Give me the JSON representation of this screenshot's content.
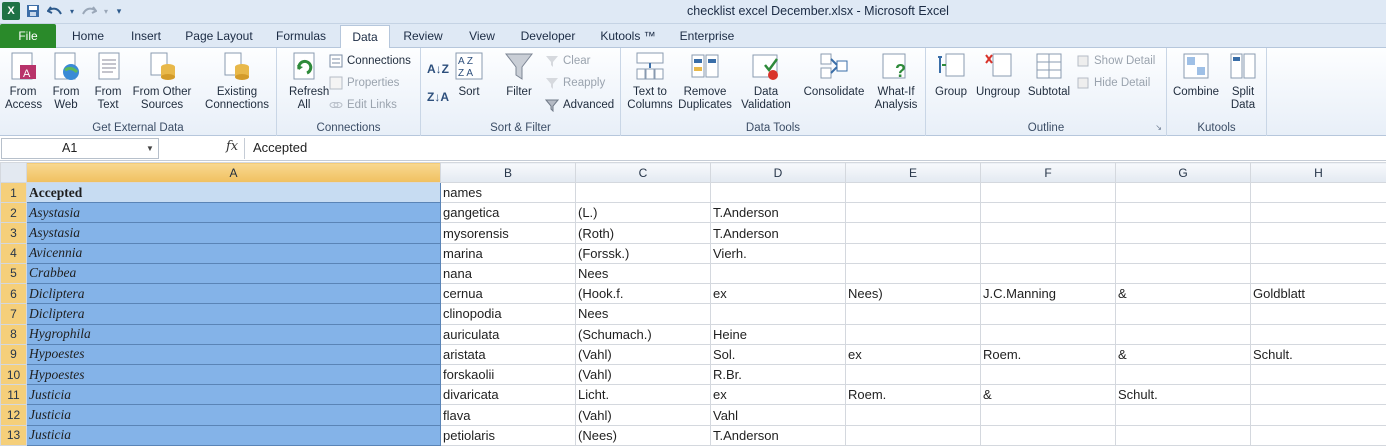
{
  "window": {
    "title": "checklist excel December.xlsx  -  Microsoft Excel"
  },
  "tabs": [
    "File",
    "Home",
    "Insert",
    "Page Layout",
    "Formulas",
    "Data",
    "Review",
    "View",
    "Developer",
    "Kutools ™",
    "Enterprise"
  ],
  "active_tab": "Data",
  "ribbon": {
    "get_external": {
      "label": "Get External Data",
      "from_access": "From Access",
      "from_web": "From Web",
      "from_text": "From Text",
      "from_other": "From Other Sources",
      "existing": "Existing Connections"
    },
    "connections": {
      "label": "Connections",
      "refresh": "Refresh All",
      "connections": "Connections",
      "properties": "Properties",
      "edit_links": "Edit Links"
    },
    "sort_filter": {
      "label": "Sort & Filter",
      "sort": "Sort",
      "filter": "Filter",
      "clear": "Clear",
      "reapply": "Reapply",
      "advanced": "Advanced"
    },
    "data_tools": {
      "label": "Data Tools",
      "text_to_columns": "Text to Columns",
      "remove_duplicates": "Remove Duplicates",
      "data_validation": "Data Validation",
      "consolidate": "Consolidate",
      "what_if": "What-If Analysis"
    },
    "outline": {
      "label": "Outline",
      "group": "Group",
      "ungroup": "Ungroup",
      "subtotal": "Subtotal",
      "show_detail": "Show Detail",
      "hide_detail": "Hide Detail"
    },
    "kutools": {
      "label": "Kutools",
      "combine": "Combine",
      "split_data": "Split Data"
    }
  },
  "formula_bar": {
    "name_box": "A1",
    "fx": "fx",
    "value": "Accepted"
  },
  "columns": [
    "A",
    "B",
    "C",
    "D",
    "E",
    "F",
    "G",
    "H"
  ],
  "rows": [
    {
      "n": "1",
      "cells": [
        "Accepted",
        "names",
        "",
        "",
        "",
        "",
        "",
        ""
      ]
    },
    {
      "n": "2",
      "cells": [
        "Asystasia",
        "gangetica",
        "(L.)",
        "T.Anderson",
        "",
        "",
        "",
        ""
      ]
    },
    {
      "n": "3",
      "cells": [
        "Asystasia",
        "mysorensis",
        "(Roth)",
        "T.Anderson",
        "",
        "",
        "",
        ""
      ]
    },
    {
      "n": "4",
      "cells": [
        "Avicennia",
        "marina",
        "(Forssk.)",
        "Vierh.",
        "",
        "",
        "",
        ""
      ]
    },
    {
      "n": "5",
      "cells": [
        "Crabbea",
        "nana",
        "Nees",
        "",
        "",
        "",
        "",
        ""
      ]
    },
    {
      "n": "6",
      "cells": [
        "Dicliptera",
        "cernua",
        "(Hook.f.",
        "ex",
        "Nees)",
        "J.C.Manning",
        "&",
        "Goldblatt"
      ]
    },
    {
      "n": "7",
      "cells": [
        "Dicliptera",
        "clinopodia",
        "Nees",
        "",
        "",
        "",
        "",
        ""
      ]
    },
    {
      "n": "8",
      "cells": [
        "Hygrophila",
        "auriculata",
        "(Schumach.)",
        "Heine",
        "",
        "",
        "",
        ""
      ]
    },
    {
      "n": "9",
      "cells": [
        "Hypoestes",
        "aristata",
        "(Vahl)",
        "Sol.",
        "ex",
        "Roem.",
        "&",
        "Schult."
      ]
    },
    {
      "n": "10",
      "cells": [
        "Hypoestes",
        "forskaolii",
        "(Vahl)",
        "R.Br.",
        "",
        "",
        "",
        ""
      ]
    },
    {
      "n": "11",
      "cells": [
        "Justicia",
        "divaricata",
        "Licht.",
        "ex",
        "Roem.",
        "&",
        "Schult.",
        ""
      ]
    },
    {
      "n": "12",
      "cells": [
        "Justicia",
        "flava",
        "(Vahl)",
        "Vahl",
        "",
        "",
        "",
        ""
      ]
    },
    {
      "n": "13",
      "cells": [
        "Justicia",
        "petiolaris",
        "(Nees)",
        "T.Anderson",
        "",
        "",
        "",
        ""
      ]
    }
  ]
}
